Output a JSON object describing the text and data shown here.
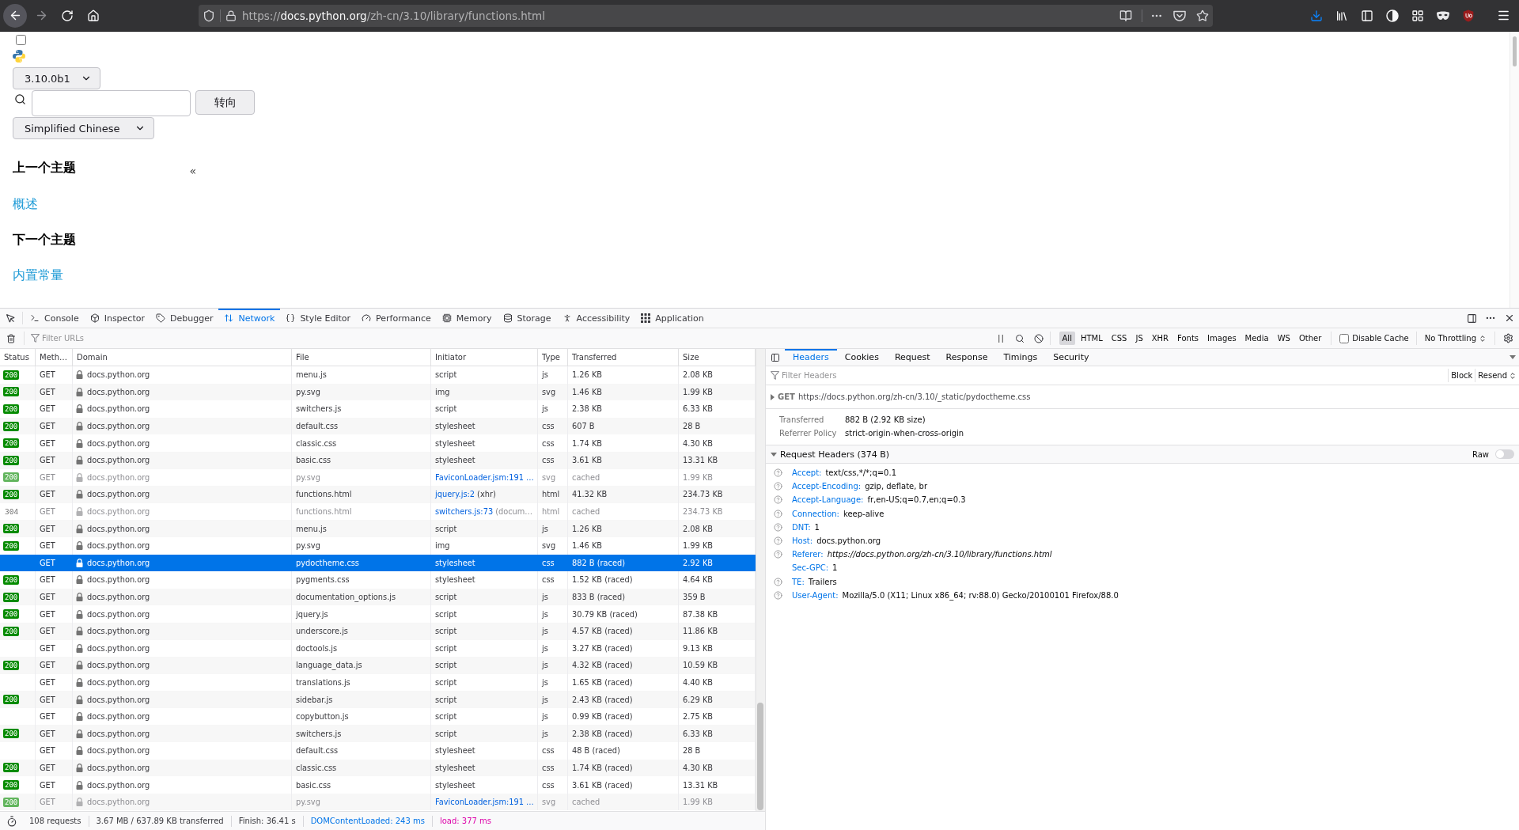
{
  "browser": {
    "back_button": {
      "highlighted": true
    },
    "forward_button": {
      "disabled": true
    },
    "url": {
      "scheme": "https://",
      "host": "docs.python.org",
      "path": "/zh-cn/3.10/library/functions.html"
    }
  },
  "page": {
    "menu_checkbox": {
      "checked": false
    },
    "version_select": "3.10.0b1",
    "search": {
      "button": "转向"
    },
    "language_select": "Simplified Chinese",
    "collapse_button": "«",
    "sidebar": [
      {
        "heading": "上一个主题",
        "link": "概述"
      },
      {
        "heading": "下一个主题",
        "link": "内置常量"
      }
    ]
  },
  "devtools": {
    "tabs": [
      {
        "label": "Console",
        "selected": false
      },
      {
        "label": "Inspector",
        "selected": false
      },
      {
        "label": "Debugger",
        "selected": false
      },
      {
        "label": "Network",
        "selected": true
      },
      {
        "label": "Style Editor",
        "selected": false
      },
      {
        "label": "Performance",
        "selected": false
      },
      {
        "label": "Memory",
        "selected": false
      },
      {
        "label": "Storage",
        "selected": false
      },
      {
        "label": "Accessibility",
        "selected": false
      },
      {
        "label": "Application",
        "selected": false
      }
    ],
    "toolbar": {
      "filter_placeholder": "Filter URLs",
      "type_filters": [
        {
          "label": "All",
          "selected": true
        },
        {
          "label": "HTML",
          "selected": false
        },
        {
          "label": "CSS",
          "selected": false
        },
        {
          "label": "JS",
          "selected": false
        },
        {
          "label": "XHR",
          "selected": false
        },
        {
          "label": "Fonts",
          "selected": false
        },
        {
          "label": "Images",
          "selected": false
        },
        {
          "label": "Media",
          "selected": false
        },
        {
          "label": "WS",
          "selected": false
        },
        {
          "label": "Other",
          "selected": false
        }
      ],
      "disable_cache": {
        "label": "Disable Cache",
        "checked": false
      },
      "throttling": "No Throttling"
    }
  },
  "network": {
    "columns": [
      "Status",
      "Meth…",
      "Domain",
      "File",
      "Initiator",
      "Type",
      "Transferred",
      "Size"
    ],
    "rows": [
      {
        "status": {
          "code": "200",
          "kind": "badge"
        },
        "method": "GET",
        "domain": "docs.python.org",
        "file": "menu.js",
        "initiator": "script",
        "type": "js",
        "transferred": "1.26 KB",
        "size": "2.08 KB",
        "selected": false,
        "dimmed": false
      },
      {
        "status": {
          "code": "200",
          "kind": "badge"
        },
        "method": "GET",
        "domain": "docs.python.org",
        "file": "py.svg",
        "initiator": "img",
        "type": "svg",
        "transferred": "1.46 KB",
        "size": "1.99 KB",
        "selected": false,
        "dimmed": false
      },
      {
        "status": {
          "code": "200",
          "kind": "badge"
        },
        "method": "GET",
        "domain": "docs.python.org",
        "file": "switchers.js",
        "initiator": "script",
        "type": "js",
        "transferred": "2.38 KB",
        "size": "6.33 KB",
        "selected": false,
        "dimmed": false
      },
      {
        "status": {
          "code": "200",
          "kind": "badge"
        },
        "method": "GET",
        "domain": "docs.python.org",
        "file": "default.css",
        "initiator": "stylesheet",
        "type": "css",
        "transferred": "607 B",
        "size": "28 B",
        "selected": false,
        "dimmed": false
      },
      {
        "status": {
          "code": "200",
          "kind": "badge"
        },
        "method": "GET",
        "domain": "docs.python.org",
        "file": "classic.css",
        "initiator": "stylesheet",
        "type": "css",
        "transferred": "1.74 KB",
        "size": "4.30 KB",
        "selected": false,
        "dimmed": false
      },
      {
        "status": {
          "code": "200",
          "kind": "badge"
        },
        "method": "GET",
        "domain": "docs.python.org",
        "file": "basic.css",
        "initiator": "stylesheet",
        "type": "css",
        "transferred": "3.61 KB",
        "size": "13.31 KB",
        "selected": false,
        "dimmed": false
      },
      {
        "status": {
          "code": "200",
          "kind": "badge"
        },
        "method": "GET",
        "domain": "docs.python.org",
        "file": "py.svg",
        "initiator_link": "FaviconLoader.jsm:191 …",
        "type": "svg",
        "transferred": "cached",
        "size": "1.99 KB",
        "selected": false,
        "dimmed": true
      },
      {
        "status": {
          "code": "200",
          "kind": "badge"
        },
        "method": "GET",
        "domain": "docs.python.org",
        "file": "functions.html",
        "initiator_link": "jquery.js:2",
        "initiator_note": "(xhr)",
        "type": "html",
        "transferred": "41.32 KB",
        "size": "234.73 KB",
        "selected": false,
        "dimmed": false
      },
      {
        "status": {
          "code": "304",
          "kind": "plain"
        },
        "method": "GET",
        "domain": "docs.python.org",
        "file": "functions.html",
        "initiator_link": "switchers.js:73",
        "initiator_note": "(docum…",
        "type": "html",
        "transferred": "cached",
        "size": "234.73 KB",
        "selected": false,
        "dimmed": true
      },
      {
        "status": {
          "code": "200",
          "kind": "badge"
        },
        "method": "GET",
        "domain": "docs.python.org",
        "file": "menu.js",
        "initiator": "script",
        "type": "js",
        "transferred": "1.26 KB",
        "size": "2.08 KB",
        "selected": false,
        "dimmed": false
      },
      {
        "status": {
          "code": "200",
          "kind": "badge"
        },
        "method": "GET",
        "domain": "docs.python.org",
        "file": "py.svg",
        "initiator": "img",
        "type": "svg",
        "transferred": "1.46 KB",
        "size": "1.99 KB",
        "selected": false,
        "dimmed": false
      },
      {
        "method": "GET",
        "domain": "docs.python.org",
        "file": "pydoctheme.css",
        "initiator": "stylesheet",
        "type": "css",
        "transferred": "882 B (raced)",
        "size": "2.92 KB",
        "selected": true,
        "dimmed": false
      },
      {
        "status": {
          "code": "200",
          "kind": "badge"
        },
        "method": "GET",
        "domain": "docs.python.org",
        "file": "pygments.css",
        "initiator": "stylesheet",
        "type": "css",
        "transferred": "1.52 KB (raced)",
        "size": "4.64 KB",
        "selected": false,
        "dimmed": false
      },
      {
        "status": {
          "code": "200",
          "kind": "badge"
        },
        "method": "GET",
        "domain": "docs.python.org",
        "file": "documentation_options.js",
        "initiator": "script",
        "type": "js",
        "transferred": "833 B (raced)",
        "size": "359 B",
        "selected": false,
        "dimmed": false
      },
      {
        "status": {
          "code": "200",
          "kind": "badge"
        },
        "method": "GET",
        "domain": "docs.python.org",
        "file": "jquery.js",
        "initiator": "script",
        "type": "js",
        "transferred": "30.79 KB (raced)",
        "size": "87.38 KB",
        "selected": false,
        "dimmed": false
      },
      {
        "status": {
          "code": "200",
          "kind": "badge"
        },
        "method": "GET",
        "domain": "docs.python.org",
        "file": "underscore.js",
        "initiator": "script",
        "type": "js",
        "transferred": "4.57 KB (raced)",
        "size": "11.86 KB",
        "selected": false,
        "dimmed": false
      },
      {
        "method": "GET",
        "domain": "docs.python.org",
        "file": "doctools.js",
        "initiator": "script",
        "type": "js",
        "transferred": "3.27 KB (raced)",
        "size": "9.13 KB",
        "selected": false,
        "dimmed": false
      },
      {
        "status": {
          "code": "200",
          "kind": "badge"
        },
        "method": "GET",
        "domain": "docs.python.org",
        "file": "language_data.js",
        "initiator": "script",
        "type": "js",
        "transferred": "4.32 KB (raced)",
        "size": "10.59 KB",
        "selected": false,
        "dimmed": false
      },
      {
        "method": "GET",
        "domain": "docs.python.org",
        "file": "translations.js",
        "initiator": "script",
        "type": "js",
        "transferred": "1.65 KB (raced)",
        "size": "4.40 KB",
        "selected": false,
        "dimmed": false
      },
      {
        "status": {
          "code": "200",
          "kind": "badge"
        },
        "method": "GET",
        "domain": "docs.python.org",
        "file": "sidebar.js",
        "initiator": "script",
        "type": "js",
        "transferred": "2.43 KB (raced)",
        "size": "6.29 KB",
        "selected": false,
        "dimmed": false
      },
      {
        "method": "GET",
        "domain": "docs.python.org",
        "file": "copybutton.js",
        "initiator": "script",
        "type": "js",
        "transferred": "0.99 KB (raced)",
        "size": "2.75 KB",
        "selected": false,
        "dimmed": false
      },
      {
        "status": {
          "code": "200",
          "kind": "badge"
        },
        "method": "GET",
        "domain": "docs.python.org",
        "file": "switchers.js",
        "initiator": "script",
        "type": "js",
        "transferred": "2.38 KB (raced)",
        "size": "6.33 KB",
        "selected": false,
        "dimmed": false
      },
      {
        "method": "GET",
        "domain": "docs.python.org",
        "file": "default.css",
        "initiator": "stylesheet",
        "type": "css",
        "transferred": "48 B (raced)",
        "size": "28 B",
        "selected": false,
        "dimmed": false
      },
      {
        "status": {
          "code": "200",
          "kind": "badge"
        },
        "method": "GET",
        "domain": "docs.python.org",
        "file": "classic.css",
        "initiator": "stylesheet",
        "type": "css",
        "transferred": "1.74 KB (raced)",
        "size": "4.30 KB",
        "selected": false,
        "dimmed": false
      },
      {
        "status": {
          "code": "200",
          "kind": "badge"
        },
        "method": "GET",
        "domain": "docs.python.org",
        "file": "basic.css",
        "initiator": "stylesheet",
        "type": "css",
        "transferred": "3.61 KB (raced)",
        "size": "13.31 KB",
        "selected": false,
        "dimmed": false
      },
      {
        "status": {
          "code": "200",
          "kind": "badge"
        },
        "method": "GET",
        "domain": "docs.python.org",
        "file": "py.svg",
        "initiator_link": "FaviconLoader.jsm:191 …",
        "type": "svg",
        "transferred": "cached",
        "size": "1.99 KB",
        "selected": false,
        "dimmed": true
      }
    ]
  },
  "status_bar": {
    "requests": "108 requests",
    "transferred": "3.67 MB / 637.89 KB transferred",
    "finish": "Finish: 36.41 s",
    "dom_content_loaded": "DOMContentLoaded: 243 ms",
    "load": "load: 377 ms"
  },
  "details": {
    "tabs": [
      {
        "label": "Headers",
        "selected": true
      },
      {
        "label": "Cookies",
        "selected": false
      },
      {
        "label": "Request",
        "selected": false
      },
      {
        "label": "Response",
        "selected": false
      },
      {
        "label": "Timings",
        "selected": false
      },
      {
        "label": "Security",
        "selected": false
      }
    ],
    "filter_placeholder": "Filter Headers",
    "actions": [
      "Block",
      "Resend"
    ],
    "request": {
      "method": "GET",
      "url": "https://docs.python.org/zh-cn/3.10/_static/pydoctheme.css",
      "expanded": false
    },
    "summary": [
      {
        "label": "Transferred",
        "value": "882 B (2.92 KB size)"
      },
      {
        "label": "Referrer Policy",
        "value": "strict-origin-when-cross-origin"
      }
    ],
    "request_headers": {
      "title": "Request Headers (374 B)",
      "expanded": true,
      "raw": {
        "label": "Raw",
        "on": false
      },
      "headers": [
        {
          "name": "Accept:",
          "value": "text/css,*/*;q=0.1",
          "help": true,
          "kind": "plain"
        },
        {
          "name": "Accept-Encoding:",
          "value": "gzip, deflate, br",
          "help": true,
          "kind": "plain"
        },
        {
          "name": "Accept-Language:",
          "value": "fr,en-US;q=0.7,en;q=0.3",
          "help": true,
          "kind": "plain"
        },
        {
          "name": "Connection:",
          "value": "keep-alive",
          "help": true,
          "kind": "plain"
        },
        {
          "name": "DNT:",
          "value": "1",
          "help": true,
          "kind": "plain"
        },
        {
          "name": "Host:",
          "value": "docs.python.org",
          "help": true,
          "kind": "plain"
        },
        {
          "name": "Referer:",
          "value": "https://docs.python.org/zh-cn/3.10/library/functions.html",
          "help": true,
          "kind": "url"
        },
        {
          "name": "Sec-GPC:",
          "value": "1",
          "help": false,
          "kind": "plain"
        },
        {
          "name": "TE:",
          "value": "Trailers",
          "help": true,
          "kind": "plain"
        },
        {
          "name": "User-Agent:",
          "value": "Mozilla/5.0 (X11; Linux x86_64; rv:88.0) Gecko/20100101 Firefox/88.0",
          "help": true,
          "kind": "plain"
        }
      ]
    }
  }
}
